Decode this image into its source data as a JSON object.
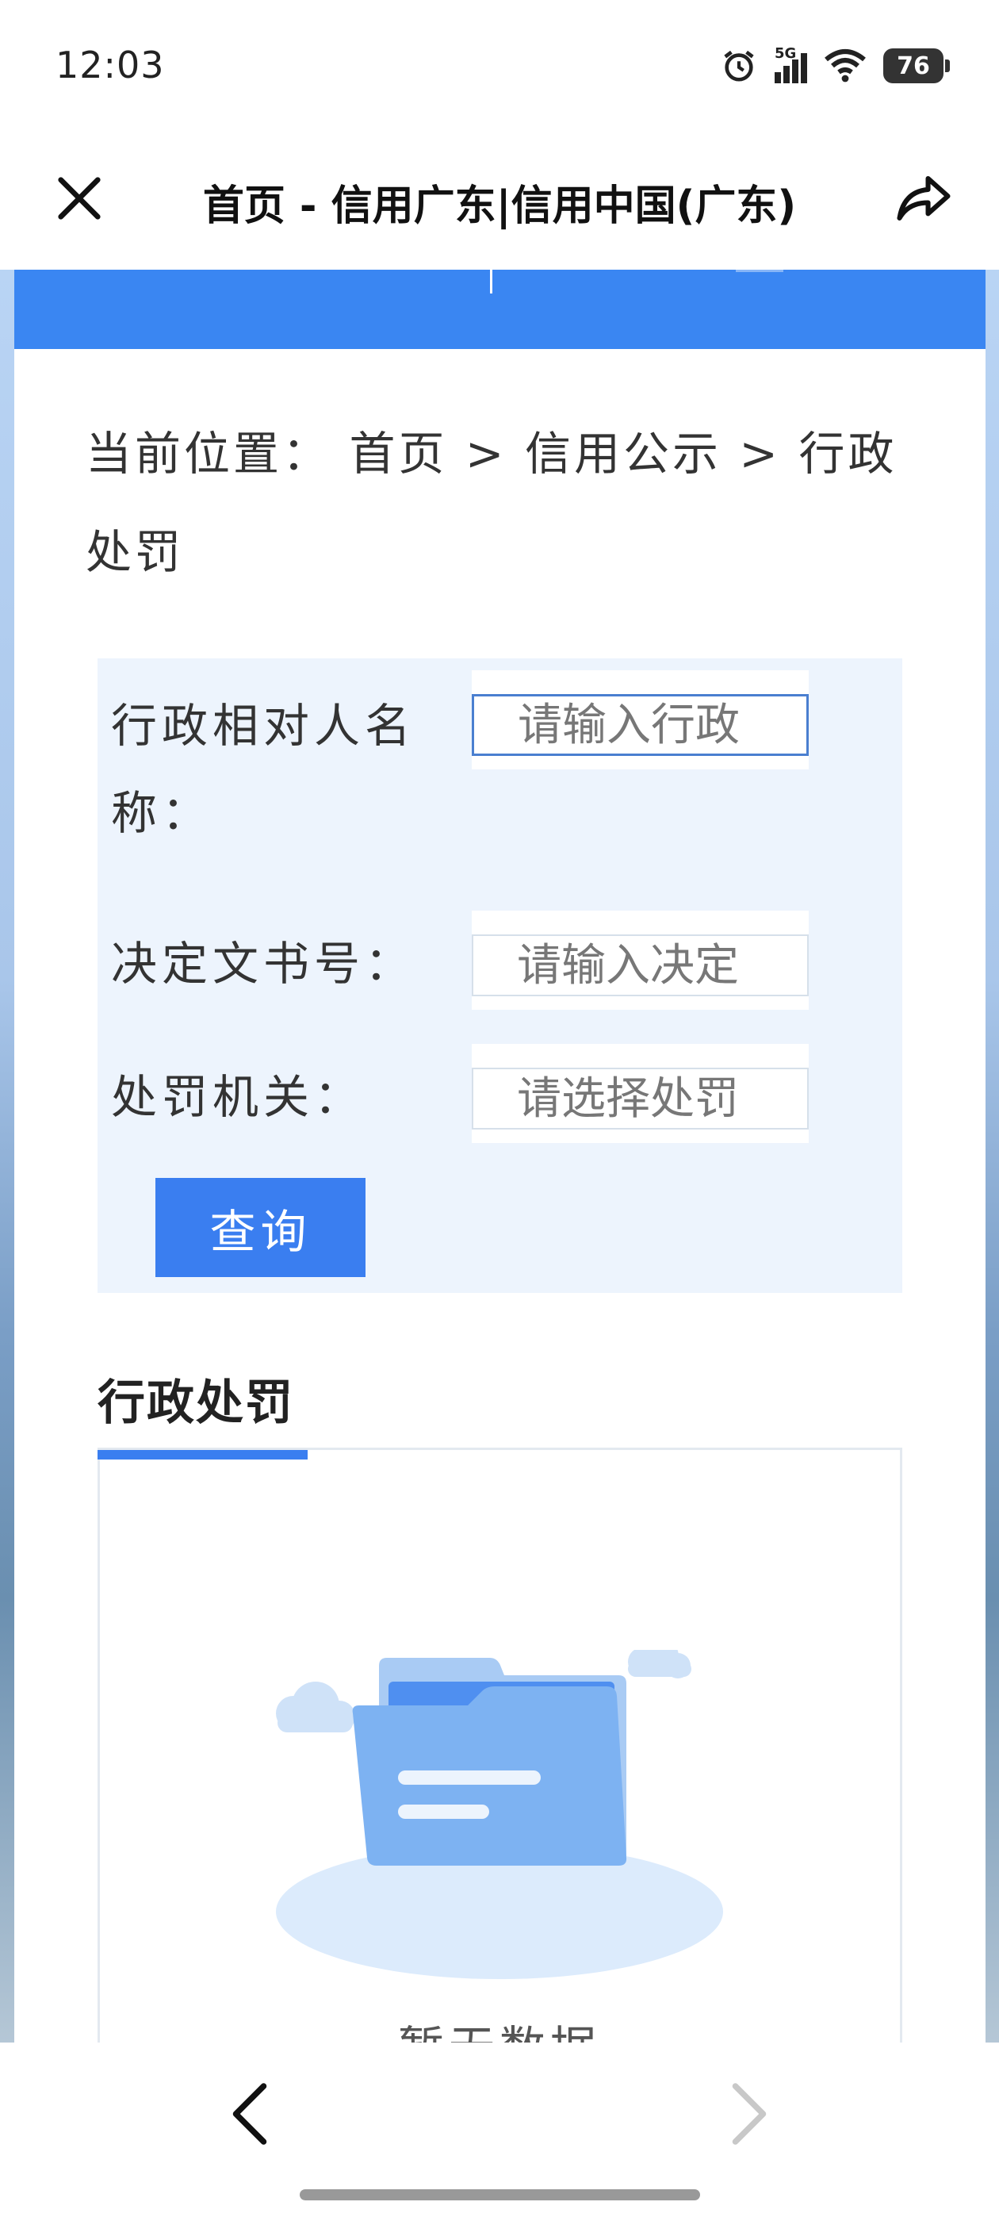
{
  "status_bar": {
    "time": "12:03",
    "network": "5G",
    "battery": "76"
  },
  "title_bar": {
    "title": "首页 - 信用广东|信用中国(广东)",
    "close_icon": "close-icon",
    "share_icon": "share-icon"
  },
  "breadcrumb": {
    "prefix": "当前位置：",
    "items": [
      "首页",
      "信用公示",
      "行政处罚"
    ],
    "separator": ">"
  },
  "search_form": {
    "name_label": "行政相对人名称：",
    "name_placeholder": "请输入行政",
    "doc_label": "决定文书号：",
    "doc_placeholder": "请输入决定",
    "org_label": "处罚机关：",
    "org_placeholder": "请选择处罚",
    "query_button": "查询"
  },
  "section": {
    "title": "行政处罚",
    "empty_text": "暂无数据"
  },
  "colors": {
    "primary": "#3a7ef0",
    "panel_bg": "#edf4fd"
  }
}
